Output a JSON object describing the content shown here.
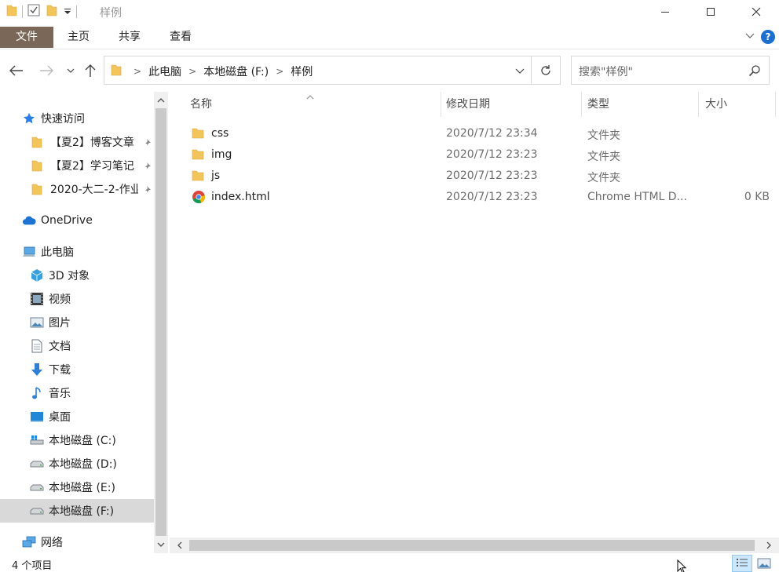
{
  "window": {
    "title": "样例",
    "minimize_glyph": "—",
    "maximize_glyph": "☐",
    "close_glyph": "✕"
  },
  "ribbon": {
    "tabs": [
      {
        "label": "文件"
      },
      {
        "label": "主页"
      },
      {
        "label": "共享"
      },
      {
        "label": "查看"
      }
    ],
    "help_glyph": "?"
  },
  "address": {
    "crumbs": [
      "此电脑",
      "本地磁盘 (F:)",
      "样例"
    ],
    "chevron": ">"
  },
  "search": {
    "placeholder": "搜索\"样例\""
  },
  "navpane": {
    "quick_access": "快速访问",
    "pinned": [
      {
        "label": "【夏2】博客文章"
      },
      {
        "label": "【夏2】学习笔记"
      },
      {
        "label": "2020-大二-2-作业"
      }
    ],
    "onedrive": "OneDrive",
    "this_pc": "此电脑",
    "pc_items": [
      {
        "label": "3D 对象",
        "icon": "3d-objects-icon"
      },
      {
        "label": "视频",
        "icon": "video-icon"
      },
      {
        "label": "图片",
        "icon": "pictures-icon"
      },
      {
        "label": "文档",
        "icon": "documents-icon"
      },
      {
        "label": "下载",
        "icon": "download-icon"
      },
      {
        "label": "音乐",
        "icon": "music-icon"
      },
      {
        "label": "桌面",
        "icon": "desktop-icon"
      },
      {
        "label": "本地磁盘 (C:)",
        "icon": "drive-c-icon"
      },
      {
        "label": "本地磁盘 (D:)",
        "icon": "drive-icon"
      },
      {
        "label": "本地磁盘 (E:)",
        "icon": "drive-icon"
      },
      {
        "label": "本地磁盘 (F:)",
        "icon": "drive-icon"
      }
    ],
    "network": "网络"
  },
  "filelist": {
    "columns": {
      "name": "名称",
      "date": "修改日期",
      "type": "类型",
      "size": "大小"
    },
    "rows": [
      {
        "name": "css",
        "date": "2020/7/12 23:34",
        "type": "文件夹",
        "size": "",
        "icon": "folder-icon"
      },
      {
        "name": "img",
        "date": "2020/7/12 23:23",
        "type": "文件夹",
        "size": "",
        "icon": "folder-icon"
      },
      {
        "name": "js",
        "date": "2020/7/12 23:23",
        "type": "文件夹",
        "size": "",
        "icon": "folder-icon"
      },
      {
        "name": "index.html",
        "date": "2020/7/12 23:23",
        "type": "Chrome HTML D...",
        "size": "0 KB",
        "icon": "chrome-icon"
      }
    ]
  },
  "status": {
    "count": "4 个项目"
  },
  "colors": {
    "file_tab": "#7a6757",
    "folder": "#f2c55c",
    "selected": "#d9d9d9",
    "accent": "#1a6fd1"
  }
}
